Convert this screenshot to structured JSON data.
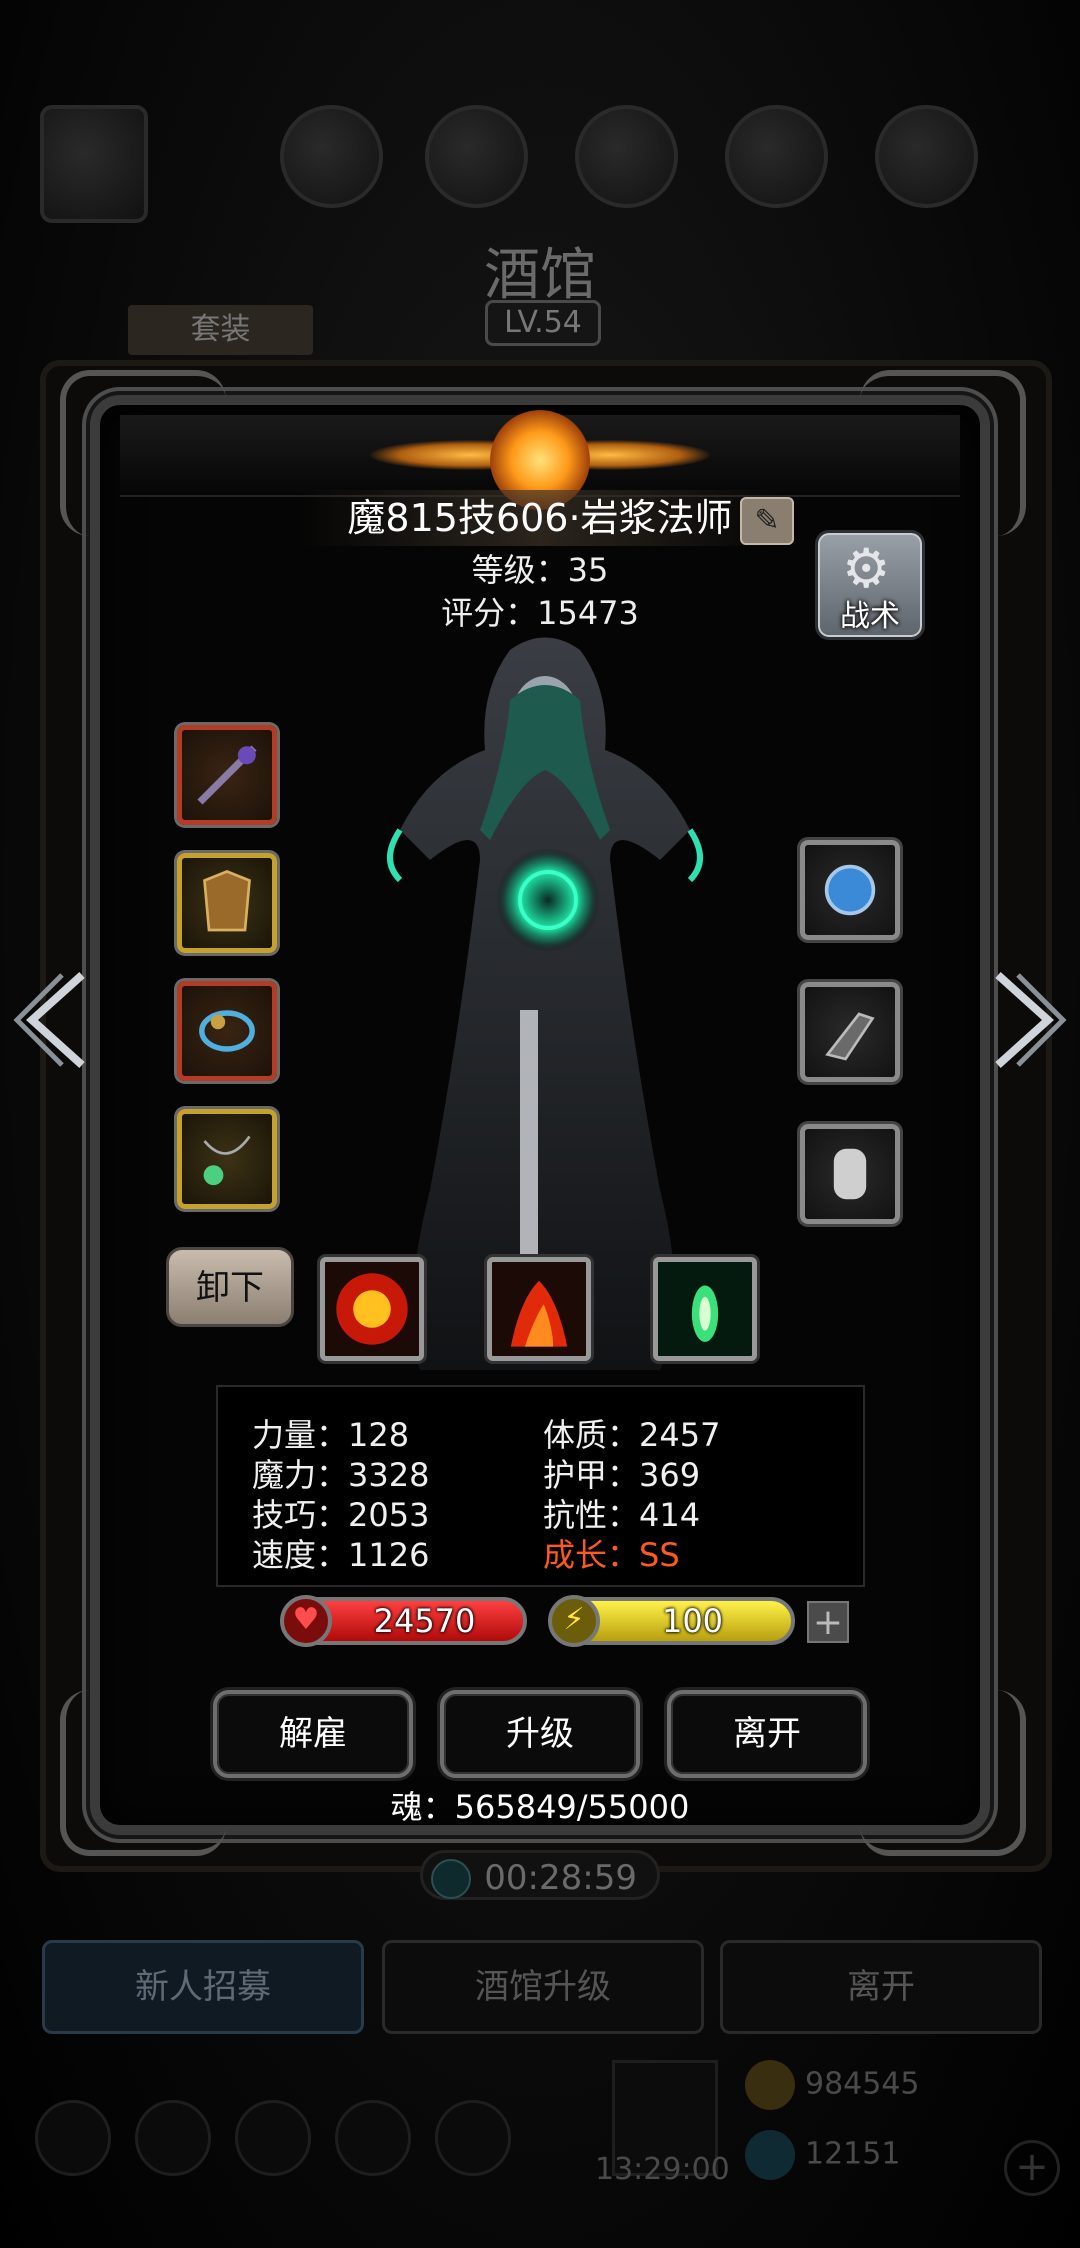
{
  "background": {
    "title": "酒馆",
    "level": "LV.54",
    "tab": "套装",
    "timer": "00:28:59",
    "buttons": [
      "新人招募",
      "酒馆升级",
      "离开"
    ],
    "gift_time": "13:29:00",
    "gold": "984545",
    "gems": "12151"
  },
  "hero": {
    "name": "魔815技606·岩浆法师",
    "level": "等级：35",
    "score": "评分：15473"
  },
  "tactics": {
    "label": "战术",
    "icon": "gear-icon"
  },
  "equipment": {
    "left": [
      {
        "name": "staff",
        "rarity": "red"
      },
      {
        "name": "armor",
        "rarity": "gold"
      },
      {
        "name": "ring",
        "rarity": "red"
      },
      {
        "name": "amulet",
        "rarity": "gold"
      }
    ],
    "right": [
      {
        "name": "orb",
        "rarity": "gray"
      },
      {
        "name": "gauntlet",
        "rarity": "gray"
      },
      {
        "name": "chainmail",
        "rarity": "gray"
      }
    ]
  },
  "unequip_label": "卸下",
  "skills": [
    "fire-burst",
    "flame",
    "green-spirit"
  ],
  "stats": {
    "strength": "力量：128",
    "magic": "魔力：3328",
    "skill": "技巧：2053",
    "speed": "速度：1126",
    "constitution": "体质：2457",
    "armor": "护甲：369",
    "resistance": "抗性：414",
    "growth": "成长：SS"
  },
  "bars": {
    "hp": "24570",
    "energy": "100"
  },
  "actions": {
    "dismiss": "解雇",
    "upgrade": "升级",
    "leave": "离开"
  },
  "soul": "魂：565849/55000",
  "colors": {
    "growth": "#ff5a1e",
    "hp": "#d81818",
    "energy": "#e6d21e",
    "rarity_red": "#b43c24",
    "rarity_gold": "#c6a12c"
  }
}
